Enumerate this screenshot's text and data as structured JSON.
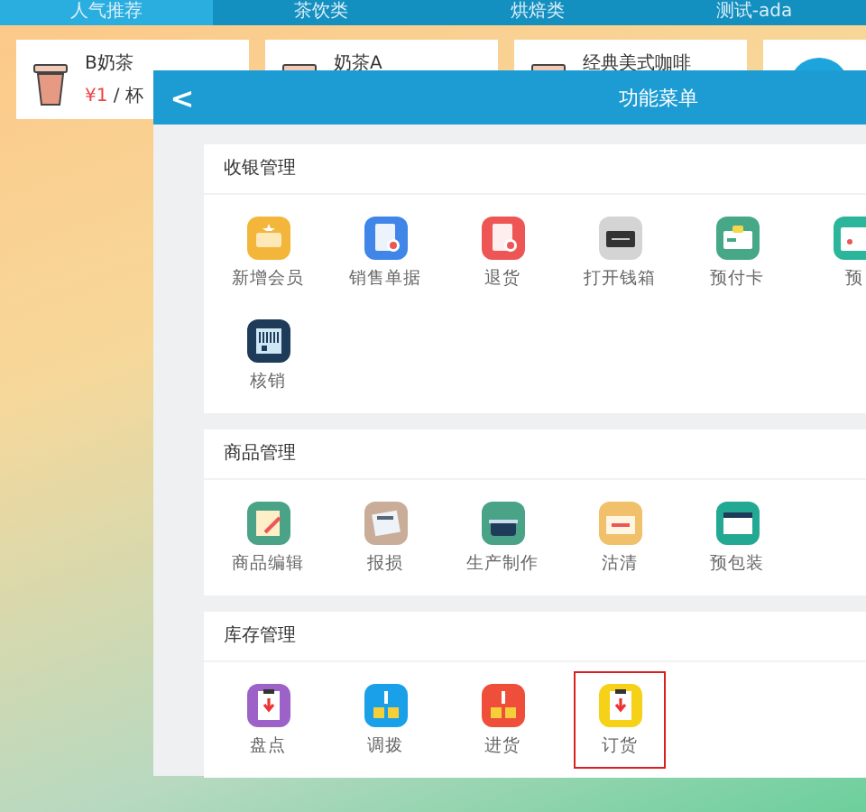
{
  "tabs": [
    {
      "label": "人气推荐",
      "selected": true
    },
    {
      "label": "茶饮类",
      "selected": false
    },
    {
      "label": "烘焙类",
      "selected": false
    },
    {
      "label": "测试-ada",
      "selected": false
    }
  ],
  "products": [
    {
      "kind": "cup",
      "name": "B奶茶",
      "price": "¥1",
      "unit": "/ 杯"
    },
    {
      "kind": "cup",
      "name": "奶茶A"
    },
    {
      "kind": "cup",
      "name": "经典美式咖啡"
    },
    {
      "kind": "circle"
    }
  ],
  "modal": {
    "back": "<",
    "title": "功能菜单",
    "sections": [
      {
        "title": "收银管理",
        "items": [
          {
            "label": "新增会员",
            "selected": false
          },
          {
            "label": "销售单据",
            "selected": false
          },
          {
            "label": "退货",
            "selected": false
          },
          {
            "label": "打开钱箱",
            "selected": false
          },
          {
            "label": "预付卡",
            "selected": false
          },
          {
            "label": "预",
            "selected": false
          },
          {
            "label": "核销",
            "selected": false
          }
        ]
      },
      {
        "title": "商品管理",
        "items": [
          {
            "label": "商品编辑",
            "selected": false
          },
          {
            "label": "报损",
            "selected": false
          },
          {
            "label": "生产制作",
            "selected": false
          },
          {
            "label": "沽清",
            "selected": false
          },
          {
            "label": "预包装",
            "selected": false
          }
        ]
      },
      {
        "title": "库存管理",
        "items": [
          {
            "label": "盘点",
            "selected": false
          },
          {
            "label": "调拨",
            "selected": false
          },
          {
            "label": "进货",
            "selected": false
          },
          {
            "label": "订货",
            "selected": true
          }
        ]
      }
    ]
  }
}
